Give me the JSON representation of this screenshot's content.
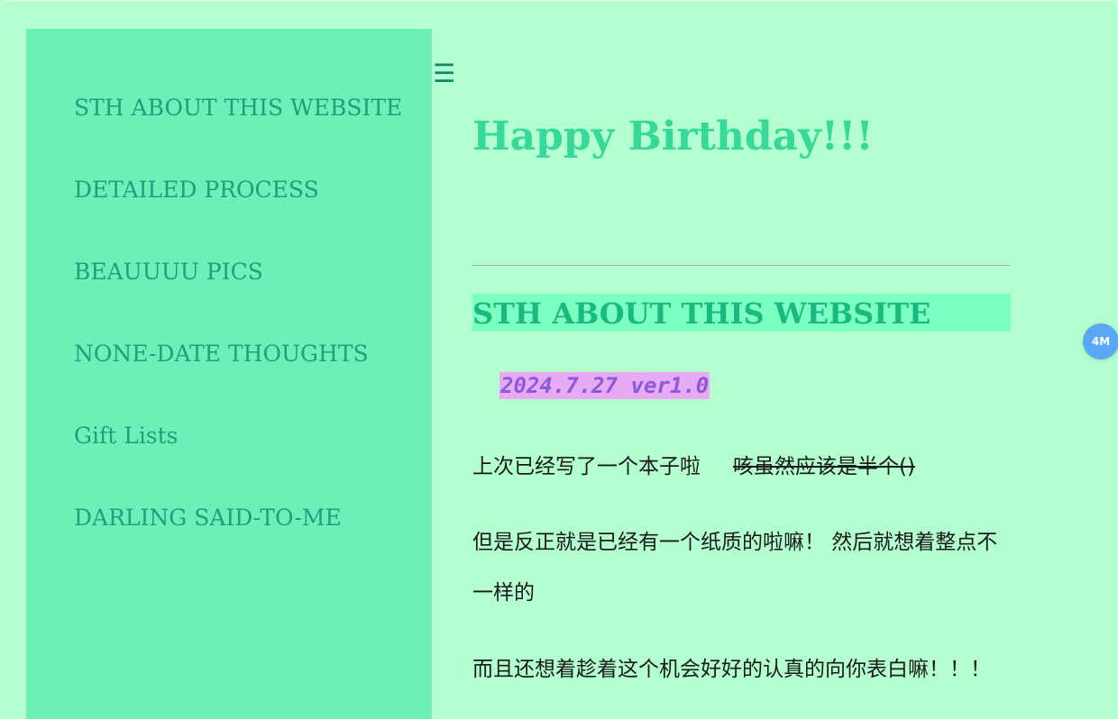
{
  "sidebar": {
    "items": [
      {
        "label": "STH ABOUT THIS WEBSITE"
      },
      {
        "label": "DETAILED PROCESS"
      },
      {
        "label": "BEAUUUU PICS"
      },
      {
        "label": "NONE-DATE THOUGHTS"
      },
      {
        "label": "Gift Lists"
      },
      {
        "label": "DARLING SAID-TO-ME"
      }
    ]
  },
  "menu_toggle": {
    "glyph": "☰",
    "icon": "hamburger-menu-icon"
  },
  "main": {
    "title": "Happy Birthday!!!",
    "section_heading": "STH ABOUT THIS WEBSITE",
    "version": "2024.7.27 ver1.0",
    "paragraphs": {
      "p1_text": "上次已经写了一个本子啦",
      "p1_strike": "咳虽然应该是半个()",
      "p2_text": "但是反正就是已经有一个纸质的啦嘛！ 然后就想着整点不一样的",
      "p3_text": "而且还想着趁着这个机会好好的认真的向你表白嘛！！！"
    }
  },
  "floating_badge": {
    "label": "4M"
  },
  "colors": {
    "page_bg": "#b3ffcf",
    "sidebar_bg": "#6df0b8",
    "nav_text": "#1f9f7a",
    "title": "#36d99a",
    "heading_bg": "#7dffc4",
    "heading_text": "#1aba7e",
    "version_bg": "#e8a9f5",
    "version_text": "#8a5bd6",
    "badge_bg": "#5aa7f6"
  }
}
